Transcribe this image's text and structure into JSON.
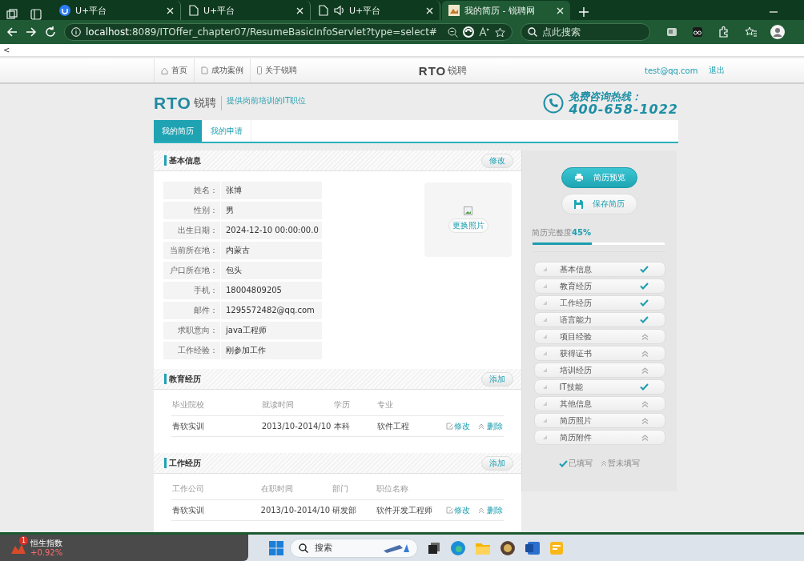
{
  "browser": {
    "tabs": [
      {
        "title": "U+平台",
        "kind": "app",
        "selected": false
      },
      {
        "title": "U+平台",
        "kind": "page",
        "selected": false
      },
      {
        "title": "U+平台",
        "kind": "audio",
        "selected": false
      },
      {
        "title": "我的简历 - 锐聘网",
        "kind": "site",
        "selected": true
      }
    ],
    "url_host": "localhost",
    "url_rest": ":8089/ITOffer_chapter07/ResumeBasicInfoServlet?type=select#",
    "search_placeholder": "点此搜索"
  },
  "page": {
    "back_text": "<",
    "nav": [
      {
        "label": "首页",
        "kind": "home"
      },
      {
        "label": "成功案例",
        "kind": "doc"
      },
      {
        "label": "关于锐聘",
        "kind": "phone"
      }
    ],
    "header_logo": {
      "mark": "RTO",
      "name": "锐聘"
    },
    "user_email": "test@qq.com",
    "logout": "退出",
    "brand": {
      "mark": "RTO",
      "name": "锐聘",
      "slogan": "提供岗前培训的IT职位",
      "hotline_label": "免费咨询热线：",
      "hotline": "400-658-1022"
    },
    "tabs": [
      {
        "label": "我的简历",
        "selected": true
      },
      {
        "label": "我的申请",
        "selected": false
      }
    ],
    "basic": {
      "title": "基本信息",
      "button": "修改",
      "photo_button": "更换照片",
      "fields": [
        {
          "label": "姓名：",
          "value": "张博"
        },
        {
          "label": "性别：",
          "value": "男"
        },
        {
          "label": "出生日期：",
          "value": "2024-12-10 00:00:00.0"
        },
        {
          "label": "当前所在地：",
          "value": "内蒙古"
        },
        {
          "label": "户口所在地：",
          "value": "包头"
        },
        {
          "label": "手机：",
          "value": "18004809205"
        },
        {
          "label": "邮件：",
          "value": "1295572482@qq.com"
        },
        {
          "label": "求职意向：",
          "value": "java工程师"
        },
        {
          "label": "工作经验：",
          "value": "刚参加工作"
        }
      ]
    },
    "tables": [
      {
        "title": "教育经历",
        "button": "添加",
        "columns": [
          "毕业院校",
          "就读时间",
          "学历",
          "专业"
        ],
        "rows": [
          {
            "cells": [
              "青软实训",
              "2013/10-2014/10",
              "本科",
              "软件工程"
            ],
            "edit": "修改",
            "delete": "删除"
          }
        ]
      },
      {
        "title": "工作经历",
        "button": "添加",
        "columns": [
          "工作公司",
          "在职时间",
          "部门",
          "职位名称"
        ],
        "rows": [
          {
            "cells": [
              "青软实训",
              "2013/10-2014/10",
              "研发部",
              "软件开发工程师"
            ],
            "edit": "修改",
            "delete": "删除"
          }
        ]
      }
    ],
    "sidebar": {
      "preview_button": "简历预览",
      "save_button": "保存简历",
      "completeness_label": "简历完整度",
      "completeness_value": "45%",
      "level": 0.45,
      "checklist": [
        {
          "label": "基本信息",
          "filled": true
        },
        {
          "label": "教育经历",
          "filled": true
        },
        {
          "label": "工作经历",
          "filled": true
        },
        {
          "label": "语言能力",
          "filled": true
        },
        {
          "label": "项目经验",
          "filled": false
        },
        {
          "label": "获得证书",
          "filled": false
        },
        {
          "label": "培训经历",
          "filled": false
        },
        {
          "label": "IT技能",
          "filled": true
        },
        {
          "label": "其他信息",
          "filled": false
        },
        {
          "label": "简历照片",
          "filled": false
        },
        {
          "label": "简历附件",
          "filled": false
        }
      ],
      "legend_filled": "已填写",
      "legend_empty": "暂未填写"
    }
  },
  "taskbar": {
    "widget_badge": "1",
    "widget_title": "恒生指数",
    "widget_change": "+0.92%",
    "search_placeholder": "搜索"
  }
}
